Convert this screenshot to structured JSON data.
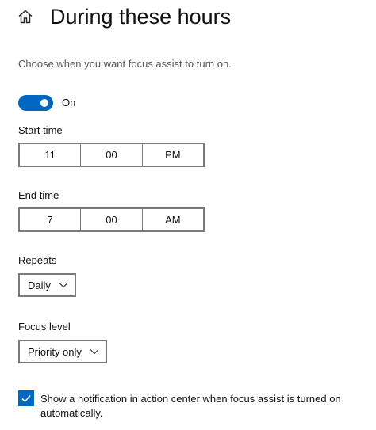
{
  "header": {
    "title": "During these hours",
    "icon": "home-icon"
  },
  "description": "Choose when you want focus assist to turn on.",
  "toggle": {
    "state_label": "On",
    "on": true,
    "accent": "#0067c0"
  },
  "start_time": {
    "label": "Start time",
    "hour": "11",
    "minute": "00",
    "period": "PM"
  },
  "end_time": {
    "label": "End time",
    "hour": "7",
    "minute": "00",
    "period": "AM"
  },
  "repeats": {
    "label": "Repeats",
    "value": "Daily"
  },
  "focus_level": {
    "label": "Focus level",
    "value": "Priority only"
  },
  "notification": {
    "checked": true,
    "text": "Show a notification in action center when focus assist is turned on automatically."
  }
}
